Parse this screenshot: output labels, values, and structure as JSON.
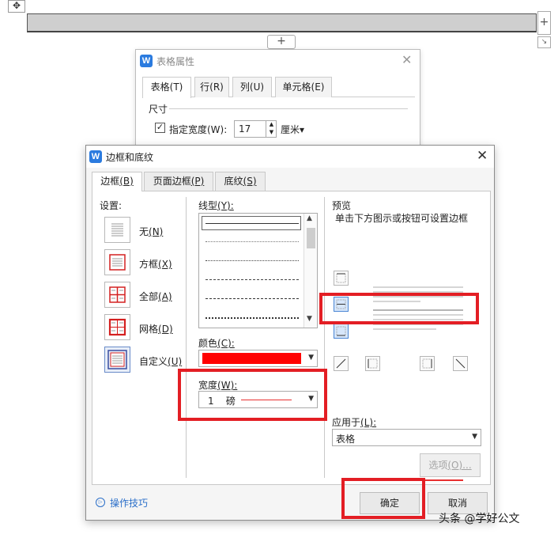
{
  "document": {
    "move_handle_glyph": "✥",
    "add_column_glyph": "+",
    "add_row_glyph": "+",
    "resize_glyph": "↘"
  },
  "table_properties": {
    "title": "表格属性",
    "close_glyph": "✕",
    "tabs": [
      {
        "label": "表格(T)",
        "active": true
      },
      {
        "label": "行(R)",
        "active": false
      },
      {
        "label": "列(U)",
        "active": false
      },
      {
        "label": "单元格(E)",
        "active": false
      }
    ],
    "size_section": "尺寸",
    "width_checkbox_glyph": "☑",
    "width_label": "指定宽度(W):",
    "width_value": "17",
    "unit": "厘米▾"
  },
  "dialog": {
    "title": "边框和底纹",
    "close_glyph": "✕",
    "tabs": [
      {
        "label": "边框",
        "key": "(B)",
        "active": true
      },
      {
        "label": "页面边框",
        "key": "(P)",
        "active": false
      },
      {
        "label": "底纹",
        "key": "(S)",
        "active": false
      }
    ],
    "settings": {
      "label": "设置:",
      "presets": [
        {
          "name": "无",
          "key": "(N)",
          "icon": "no-border-icon"
        },
        {
          "name": "方框",
          "key": "(X)",
          "icon": "box-border-icon"
        },
        {
          "name": "全部",
          "key": "(A)",
          "icon": "all-borders-icon"
        },
        {
          "name": "网格",
          "key": "(D)",
          "icon": "grid-border-icon"
        },
        {
          "name": "自定义",
          "key": "(U)",
          "icon": "custom-border-icon"
        }
      ],
      "selected": "自定义"
    },
    "line_style": {
      "label": "线型",
      "key": "(Y):",
      "items": [
        "solid",
        "dotted-fine",
        "dotted",
        "dashed",
        "dash-dot",
        "dash-dot-dot"
      ]
    },
    "color": {
      "label": "颜色",
      "key": "(C):",
      "value": "#ff0000"
    },
    "width": {
      "label": "宽度",
      "key": "(W):",
      "value": "1",
      "unit": "磅"
    },
    "preview": {
      "label": "预览",
      "hint": "单击下方图示或按钮可设置边框",
      "border_color": "#e83030"
    },
    "apply_to": {
      "label": "应用于",
      "key": "(L):",
      "value": "表格"
    },
    "options_button": {
      "label": "选项",
      "key": "(O)..."
    },
    "tips_link": "操作技巧",
    "tips_icon_glyph": "▷",
    "ok_button": "确定",
    "cancel_button": "取消"
  },
  "highlight_color": "#e31e24",
  "watermark": "头条 @学好公文"
}
